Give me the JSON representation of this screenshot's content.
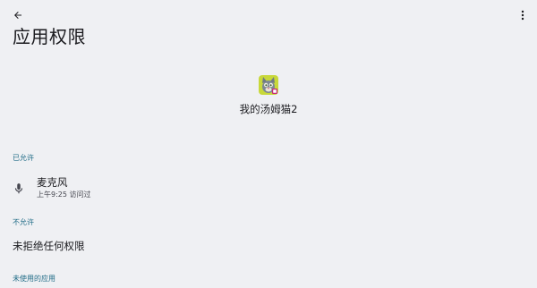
{
  "header": {
    "back_icon": "arrow-back-icon",
    "more_icon": "more-vert-icon",
    "title": "应用权限"
  },
  "app": {
    "name": "我的汤姆猫2",
    "icon": "talking-tom-app-icon"
  },
  "sections": {
    "allowed": {
      "label": "已允许",
      "items": [
        {
          "title": "麦克风",
          "subtitle": "上午9:25 访问过",
          "icon": "microphone-icon"
        }
      ]
    },
    "denied": {
      "label": "不允许",
      "empty_text": "未拒绝任何权限"
    },
    "unused": {
      "label": "未使用的应用"
    }
  },
  "colors": {
    "background": "#eff0f3",
    "section_accent": "#1f6b86",
    "text_primary": "#1b1b1f",
    "text_secondary": "#45464f"
  }
}
